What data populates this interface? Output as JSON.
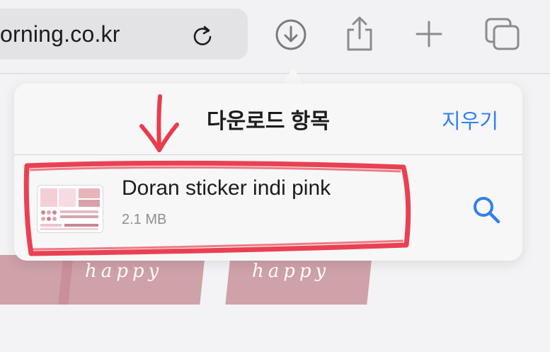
{
  "toolbar": {
    "url_text": "orning.co.kr",
    "icons": [
      "reload-icon",
      "download-icon",
      "share-icon",
      "new-tab-icon",
      "tabs-overview-icon"
    ]
  },
  "popover": {
    "title": "다운로드 항목",
    "clear_label": "지우기",
    "items": [
      {
        "name": "Doran sticker indi pink",
        "size": "2.1 MB"
      }
    ]
  },
  "background": {
    "words": [
      "happy",
      "happy"
    ]
  },
  "colors": {
    "accent": "#2f7ff2",
    "annotation": "#e8283a",
    "toolbar_bg": "#f2f2f4",
    "popover_bg": "#f7f7f8"
  }
}
